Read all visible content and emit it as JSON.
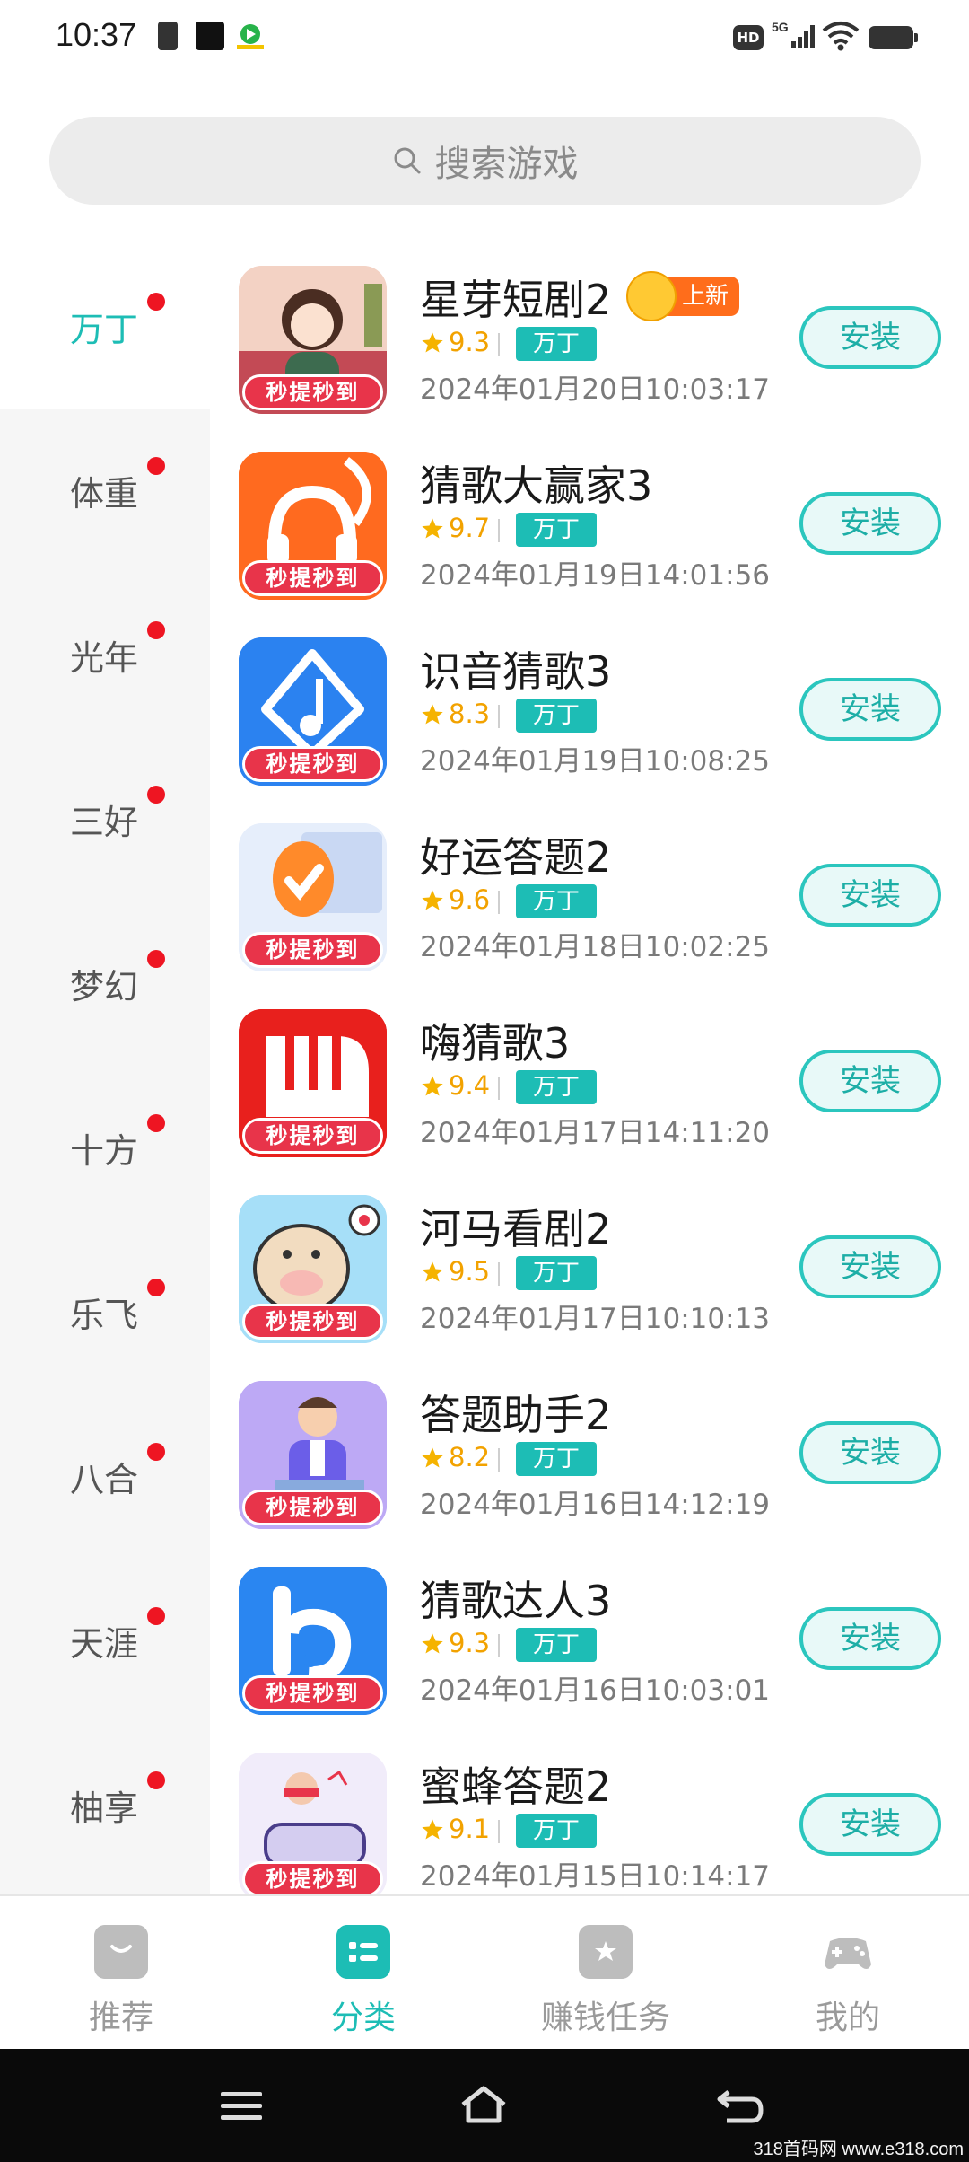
{
  "status_bar": {
    "time": "10:37",
    "icons": [
      "clipboard-icon",
      "app-notification-icon",
      "app-notification-icon",
      "hd-icon",
      "signal-5g-icon",
      "wifi-icon",
      "battery-icon"
    ],
    "hd_label": "HD",
    "network_label": "5G"
  },
  "search": {
    "placeholder": "搜索游戏"
  },
  "sidebar": {
    "items": [
      {
        "label": "万丁",
        "active": true,
        "dot": true
      },
      {
        "label": "体重",
        "active": false,
        "dot": true
      },
      {
        "label": "光年",
        "active": false,
        "dot": true
      },
      {
        "label": "三好",
        "active": false,
        "dot": true
      },
      {
        "label": "梦幻",
        "active": false,
        "dot": true
      },
      {
        "label": "十方",
        "active": false,
        "dot": true
      },
      {
        "label": "乐飞",
        "active": false,
        "dot": true
      },
      {
        "label": "八合",
        "active": false,
        "dot": true
      },
      {
        "label": "天涯",
        "active": false,
        "dot": true
      },
      {
        "label": "柚享",
        "active": false,
        "dot": true
      }
    ]
  },
  "apps": [
    {
      "title": "星芽短剧2",
      "new_badge": "上新",
      "rating": "9.3",
      "tag": "万丁",
      "date": "2024年01月20日10:03:17",
      "install": "安装",
      "icon_badge": "秒提秒到",
      "icon": "drama-girl-icon"
    },
    {
      "title": "猜歌大赢家3",
      "rating": "9.7",
      "tag": "万丁",
      "date": "2024年01月19日14:01:56",
      "install": "安装",
      "icon_badge": "秒提秒到",
      "icon": "headphones-icon"
    },
    {
      "title": "识音猜歌3",
      "rating": "8.3",
      "tag": "万丁",
      "date": "2024年01月19日10:08:25",
      "install": "安装",
      "icon_badge": "秒提秒到",
      "icon": "music-note-icon"
    },
    {
      "title": "好运答题2",
      "rating": "9.6",
      "tag": "万丁",
      "date": "2024年01月18日10:02:25",
      "install": "安装",
      "icon_badge": "秒提秒到",
      "icon": "checkmark-coin-icon"
    },
    {
      "title": "嗨猜歌3",
      "rating": "9.4",
      "tag": "万丁",
      "date": "2024年01月17日14:11:20",
      "install": "安装",
      "icon_badge": "秒提秒到",
      "icon": "piano-icon"
    },
    {
      "title": "河马看剧2",
      "rating": "9.5",
      "tag": "万丁",
      "date": "2024年01月17日10:10:13",
      "install": "安装",
      "icon_badge": "秒提秒到",
      "icon": "hippo-icon"
    },
    {
      "title": "答题助手2",
      "rating": "8.2",
      "tag": "万丁",
      "date": "2024年01月16日14:12:19",
      "install": "安装",
      "icon_badge": "秒提秒到",
      "icon": "presenter-icon"
    },
    {
      "title": "猜歌达人3",
      "rating": "9.3",
      "tag": "万丁",
      "date": "2024年01月16日10:03:01",
      "install": "安装",
      "icon_badge": "秒提秒到",
      "icon": "letter-b-note-icon"
    },
    {
      "title": "蜜蜂答题2",
      "rating": "9.1",
      "tag": "万丁",
      "date": "2024年01月15日10:14:17",
      "install": "安装",
      "icon_badge": "秒提秒到",
      "icon": "listener-icon"
    }
  ],
  "bottom_nav": {
    "items": [
      {
        "label": "推荐",
        "icon": "bag-icon",
        "active": false
      },
      {
        "label": "分类",
        "icon": "category-icon",
        "active": true
      },
      {
        "label": "赚钱任务",
        "icon": "ticket-star-icon",
        "active": false
      },
      {
        "label": "我的",
        "icon": "gamepad-icon",
        "active": false
      }
    ]
  },
  "system_nav": {
    "icons": [
      "menu-icon",
      "home-icon",
      "back-icon"
    ]
  },
  "watermark": "318首码网 www.e318.com",
  "colors": {
    "accent": "#1dbdb5",
    "dot": "#ee1522",
    "rating": "#f2a200",
    "badge": "#e8344a"
  }
}
